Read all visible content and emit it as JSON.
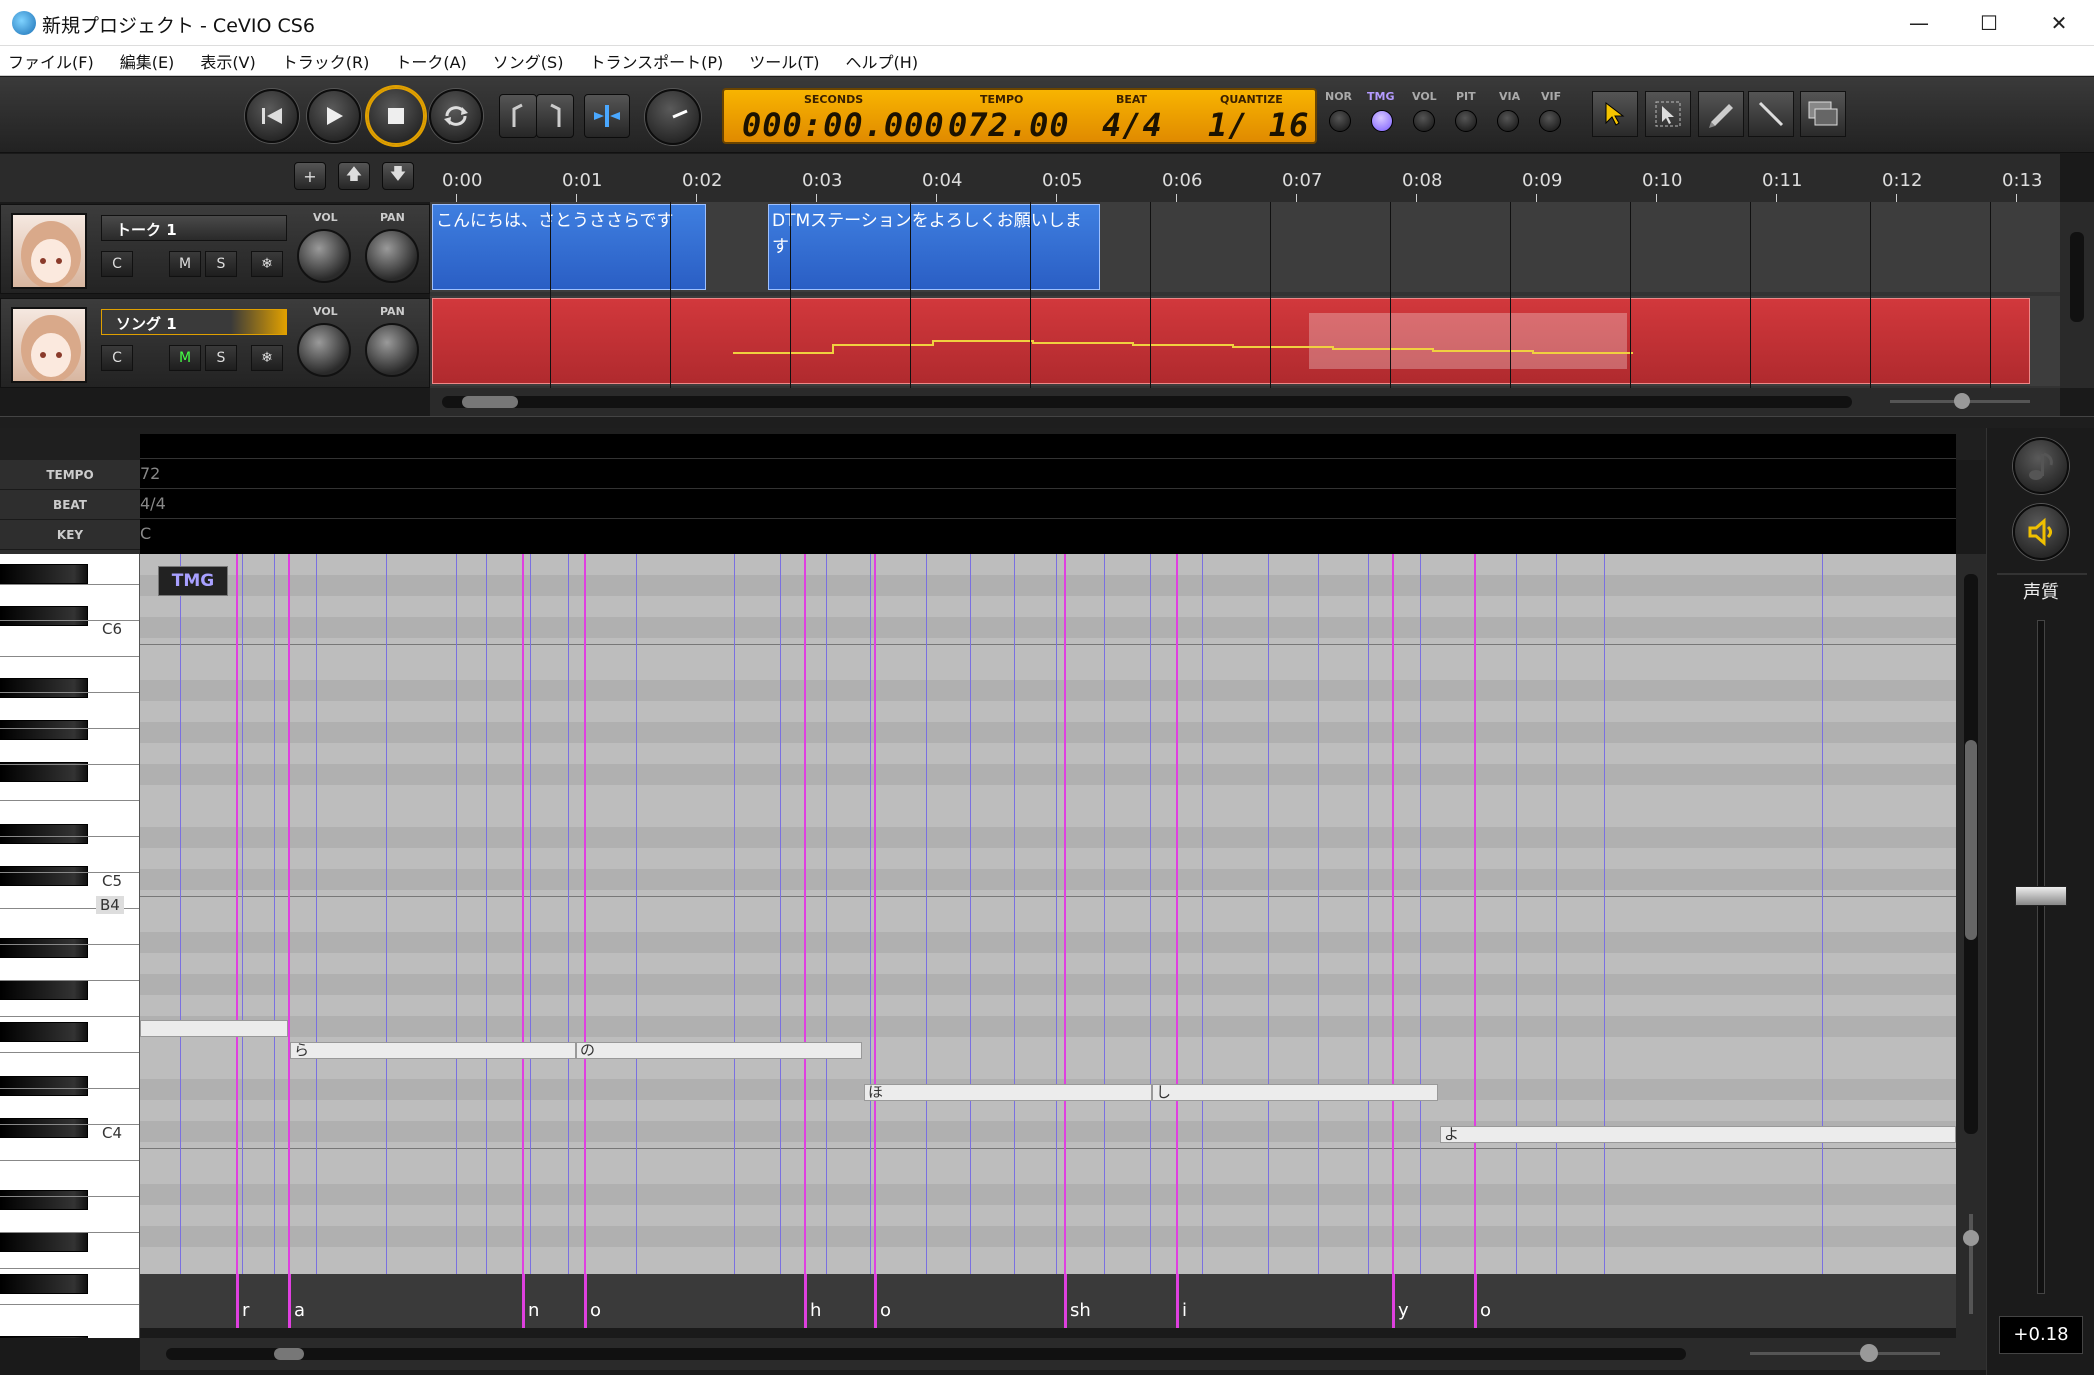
{
  "window": {
    "title": "新規プロジェクト - CeVIO CS6"
  },
  "menu": [
    "ファイル(F)",
    "編集(E)",
    "表示(V)",
    "トラック(R)",
    "トーク(A)",
    "ソング(S)",
    "トランスポート(P)",
    "ツール(T)",
    "ヘルプ(H)"
  ],
  "lcd": {
    "seconds_label": "SECONDS",
    "seconds": "000:00.000",
    "tempo_label": "TEMPO",
    "tempo": "072.00",
    "beat_label": "BEAT",
    "beat": "4/4",
    "quantize_label": "QUANTIZE",
    "quantize": "1/ 16"
  },
  "modes": [
    "NOR",
    "TMG",
    "VOL",
    "PIT",
    "VIA",
    "VIF"
  ],
  "active_mode": "TMG",
  "ruler": [
    "0:00",
    "0:01",
    "0:02",
    "0:03",
    "0:04",
    "0:05",
    "0:06",
    "0:07",
    "0:08",
    "0:09",
    "0:10",
    "0:11",
    "0:12",
    "0:13"
  ],
  "tracks": [
    {
      "name": "トーク 1",
      "buttons": [
        "C",
        "M",
        "S",
        "❄"
      ],
      "vol_label": "VOL",
      "pan_label": "PAN"
    },
    {
      "name": "ソング 1",
      "buttons": [
        "C",
        "M",
        "S",
        "❄"
      ],
      "vol_label": "VOL",
      "pan_label": "PAN"
    }
  ],
  "talk_clips": [
    "こんにちは、さとうささらです",
    "DTMステーションをよろしくお願いします"
  ],
  "info": {
    "tempo_label": "TEMPO",
    "tempo": "72",
    "beat_label": "BEAT",
    "beat": "4/4",
    "key_label": "KEY",
    "key": "C"
  },
  "tmg_tag": "TMG",
  "octaves": [
    "C6",
    "C5",
    "B4",
    "C4"
  ],
  "notes": [
    "ら",
    "の",
    "ほ",
    "し",
    "よ"
  ],
  "phonemes": [
    "r",
    "a",
    "n",
    "o",
    "h",
    "o",
    "sh",
    "i",
    "y",
    "o"
  ],
  "right_panel": {
    "label": "声質",
    "value": "+0.18"
  },
  "colors": {
    "accent": "#f0a000",
    "talk_clip": "#2f66d0",
    "song_clip": "#c03034",
    "timing_line": "#e040e0"
  }
}
